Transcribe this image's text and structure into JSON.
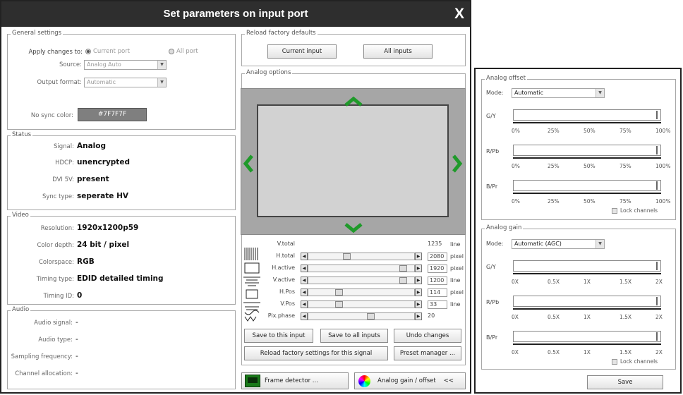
{
  "window": {
    "title": "Set parameters on input port",
    "close_label": "X"
  },
  "general": {
    "legend": "General settings",
    "apply_label": "Apply changes to:",
    "option_current": "Current port",
    "option_all": "All port",
    "source_label": "Source:",
    "source_value": "Analog Auto",
    "output_label": "Output format:",
    "output_value": "Automatic",
    "nosync_label": "No sync color:",
    "nosync_value": "#7F7F7F",
    "nosync_color": "#7F7F7F"
  },
  "status": {
    "legend": "Status",
    "rows": [
      {
        "label": "Signal:",
        "value": "Analog"
      },
      {
        "label": "HDCP:",
        "value": "unencrypted"
      },
      {
        "label": "DVI 5V:",
        "value": "present"
      },
      {
        "label": "Sync type:",
        "value": "seperate HV"
      }
    ]
  },
  "video": {
    "legend": "Video",
    "rows": [
      {
        "label": "Resolution:",
        "value": "1920x1200p59"
      },
      {
        "label": "Color depth:",
        "value": "24 bit / pixel"
      },
      {
        "label": "Colorspace:",
        "value": "RGB"
      },
      {
        "label": "Timing type:",
        "value": "EDID detailed timing"
      },
      {
        "label": "Timing ID:",
        "value": "0"
      }
    ]
  },
  "audio": {
    "legend": "Audio",
    "rows": [
      {
        "label": "Audio signal:",
        "value": "-"
      },
      {
        "label": "Audio type:",
        "value": "-"
      },
      {
        "label": "Sampling frequency:",
        "value": "-"
      },
      {
        "label": "Channel allocation:",
        "value": "-"
      }
    ]
  },
  "reload": {
    "legend": "Reload factory defaults",
    "current_input": "Current input",
    "all_inputs": "All inputs"
  },
  "analog_options": {
    "legend": "Analog options",
    "arrows": {
      "up": "⌃",
      "down": "⌄",
      "left": "‹",
      "right": "›"
    },
    "params": [
      {
        "name": "V.total",
        "value": "1235",
        "unit": "line",
        "slider": false,
        "thumb": 0
      },
      {
        "name": "H.total",
        "value": "2080",
        "unit": "pixel",
        "slider": true,
        "thumb": 0.35
      },
      {
        "name": "H.active",
        "value": "1920",
        "unit": "pixel",
        "slider": true,
        "thumb": 0.93
      },
      {
        "name": "V.active",
        "value": "1200",
        "unit": "line",
        "slider": true,
        "thumb": 0.93
      },
      {
        "name": "H.Pos",
        "value": "114",
        "unit": "pixel",
        "slider": true,
        "thumb": 0.27
      },
      {
        "name": "V.Pos",
        "value": "33",
        "unit": "line",
        "slider": true,
        "thumb": 0.27
      },
      {
        "name": "Pix.phase",
        "value": "20",
        "unit": "",
        "slider": true,
        "thumb": 0.6
      }
    ],
    "save_this": "Save to this input",
    "save_all": "Save to all inputs",
    "undo": "Undo changes",
    "reload_signal": "Reload factory settings for this signal",
    "preset_manager": "Preset manager ..."
  },
  "bottom": {
    "frame_detector": "Frame detector ...",
    "gain_offset": "Analog gain / offset",
    "collapse": "<<"
  },
  "side": {
    "offset": {
      "legend": "Analog offset",
      "mode_label": "Mode:",
      "mode_value": "Automatic",
      "scale": [
        "0%",
        "25%",
        "50%",
        "75%",
        "100%"
      ],
      "channels": [
        {
          "name": "G/Y",
          "level": 1.0
        },
        {
          "name": "R/Pb",
          "level": 1.0
        },
        {
          "name": "B/Pr",
          "level": 1.0
        }
      ],
      "lock_label": "Lock channels"
    },
    "gain": {
      "legend": "Analog gain",
      "mode_label": "Mode:",
      "mode_value": "Automatic (AGC)",
      "scale": [
        "0X",
        "0.5X",
        "1X",
        "1.5X",
        "2X"
      ],
      "channels": [
        {
          "name": "G/Y",
          "level": 1.0
        },
        {
          "name": "R/Pb",
          "level": 1.0
        },
        {
          "name": "B/Pr",
          "level": 1.0
        }
      ],
      "lock_label": "Lock channels"
    },
    "save_label": "Save"
  }
}
